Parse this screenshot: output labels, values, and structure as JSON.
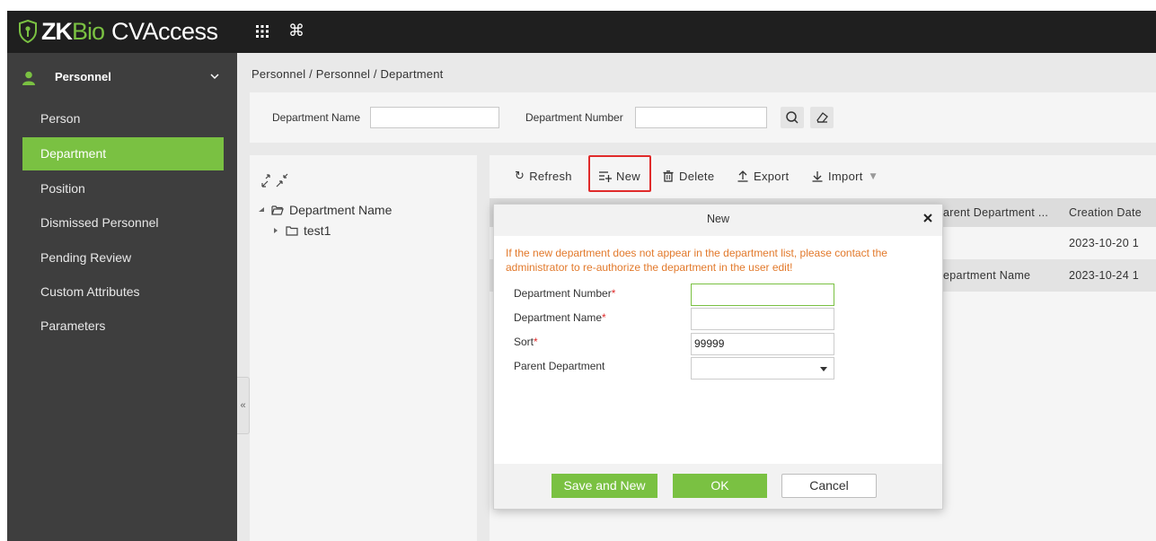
{
  "app": {
    "logo_zk": "ZK",
    "logo_bio": "Bio",
    "logo_product": "CVAccess",
    "top_icons": [
      "apps-grid-icon",
      "command-icon"
    ],
    "brand_color": "#7ac142"
  },
  "sidebar": {
    "module_title": "Personnel",
    "items": [
      {
        "label": "Person",
        "active": false
      },
      {
        "label": "Department",
        "active": true
      },
      {
        "label": "Position",
        "active": false
      },
      {
        "label": "Dismissed Personnel",
        "active": false
      },
      {
        "label": "Pending Review",
        "active": false
      },
      {
        "label": "Custom Attributes",
        "active": false
      },
      {
        "label": "Parameters",
        "active": false
      }
    ],
    "collapse_glyph": "«"
  },
  "breadcrumb": "Personnel / Personnel / Department",
  "search": {
    "dept_name_label": "Department Name",
    "dept_number_label": "Department Number"
  },
  "tree": {
    "root": "Department Name",
    "children": [
      "test1"
    ]
  },
  "toolbar": {
    "refresh": "Refresh",
    "new": "New",
    "delete": "Delete",
    "export": "Export",
    "import": "Import"
  },
  "grid": {
    "columns": [
      "arent Department ...",
      "Creation Date"
    ],
    "rows": [
      {
        "parent": "",
        "created": "2023-10-20 1"
      },
      {
        "parent": "epartment Name",
        "created": "2023-10-24 1"
      }
    ]
  },
  "dialog": {
    "title": "New",
    "message": "If the new department does not appear in the department list, please contact the administrator to re-authorize the department in the user edit!",
    "fields": {
      "number_label": "Department Number",
      "name_label": "Department Name",
      "sort_label": "Sort",
      "parent_label": "Parent Department",
      "number_value": "",
      "name_value": "",
      "sort_value": "99999",
      "parent_value": ""
    },
    "required_mark": "*",
    "buttons": {
      "save_new": "Save and New",
      "ok": "OK",
      "cancel": "Cancel"
    }
  }
}
